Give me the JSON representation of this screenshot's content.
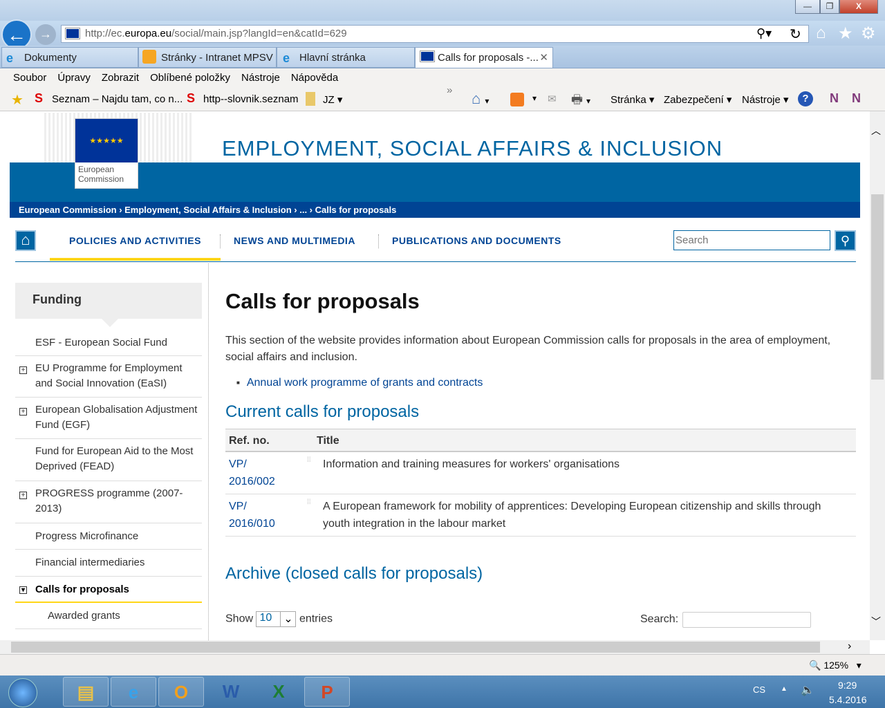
{
  "browser": {
    "url_prefix": "http://ec.",
    "url_domain": "europa.eu",
    "url_rest": "/social/main.jsp?langId=en&catId=629",
    "tabs": [
      {
        "label": "Dokumenty"
      },
      {
        "label": "Stránky - Intranet MPSV"
      },
      {
        "label": "Hlavní stránka"
      },
      {
        "label": "Calls for proposals -..."
      }
    ],
    "menu": [
      "Soubor",
      "Úpravy",
      "Zobrazit",
      "Oblíbené položky",
      "Nástroje",
      "Nápověda"
    ],
    "favorites": [
      "Seznam – Najdu tam, co n...",
      "http--slovnik.seznam",
      "JZ"
    ],
    "commands": [
      "Stránka",
      "Zabezpečení",
      "Nástroje"
    ],
    "zoom": "125%"
  },
  "site": {
    "title": "EMPLOYMENT, SOCIAL AFFAIRS & INCLUSION",
    "logo_text": "European Commission",
    "breadcrumb": [
      "European Commission",
      "Employment, Social Affairs & Inclusion",
      "...",
      "Calls for proposals"
    ],
    "nav": [
      "POLICIES AND ACTIVITIES",
      "NEWS AND MULTIMEDIA",
      "PUBLICATIONS AND DOCUMENTS"
    ],
    "search_placeholder": "Search"
  },
  "sidebar": {
    "heading": "Funding",
    "items": [
      {
        "label": "ESF - European Social Fund",
        "expand": ""
      },
      {
        "label": "EU Programme for Employment and Social Innovation (EaSI)",
        "expand": "+"
      },
      {
        "label": "European Globalisation Adjustment Fund (EGF)",
        "expand": "+"
      },
      {
        "label": "Fund for European Aid to the Most Deprived (FEAD)",
        "expand": ""
      },
      {
        "label": "PROGRESS programme (2007-2013)",
        "expand": "+"
      },
      {
        "label": "Progress Microfinance",
        "expand": ""
      },
      {
        "label": "Financial intermediaries",
        "expand": ""
      },
      {
        "label": "Calls for proposals",
        "expand": "-"
      },
      {
        "label": "Awarded grants",
        "expand": ""
      }
    ]
  },
  "main": {
    "title": "Calls for proposals",
    "intro": "This section of the website provides information about European Commission calls for proposals in the area of employment, social affairs and inclusion.",
    "link": "Annual work programme of grants and contracts",
    "current_heading": "Current calls for proposals",
    "table": {
      "headers": [
        "Ref. no.",
        "Title"
      ],
      "rows": [
        {
          "ref": "VP/ 2016/002",
          "title": "Information and training measures for workers' organisations"
        },
        {
          "ref": "VP/ 2016/010",
          "title": "A European framework for mobility of apprentices: Developing European citizenship and skills through youth integration in the labour market"
        }
      ]
    },
    "archive_heading": "Archive (closed calls for proposals)",
    "show_label": "Show",
    "show_value": "10",
    "entries_label": "entries",
    "search_label": "Search:"
  },
  "taskbar": {
    "lang": "CS",
    "time": "9:29",
    "date": "5.4.2016",
    "apps": [
      "Explorer",
      "IE",
      "Outlook",
      "Word",
      "Excel",
      "PowerPoint"
    ]
  },
  "colors": {
    "ec_blue": "#004494",
    "band_blue": "#0065a2",
    "accent_yellow": "#ffd617"
  }
}
